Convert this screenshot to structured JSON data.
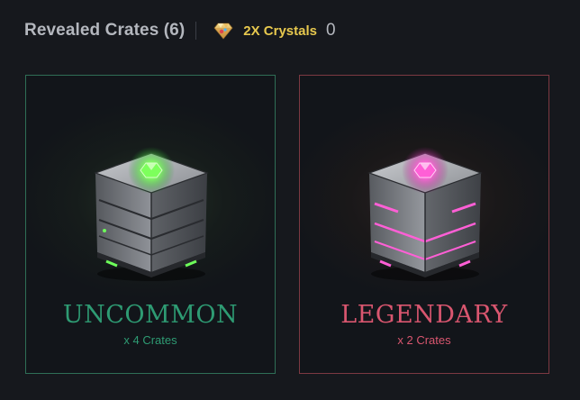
{
  "header": {
    "title": "Revealed Crates (6)",
    "crystal_label": "2X Crystals",
    "crystal_count": "0",
    "crystal_icon": "crystal-icon"
  },
  "cards": [
    {
      "rarity": "UNCOMMON",
      "count": "x 4 Crates",
      "accent": "#2e9b73",
      "glow": "#6dff5a",
      "icon": "crate-icon"
    },
    {
      "rarity": "LEGENDARY",
      "count": "x 2 Crates",
      "accent": "#d9566f",
      "glow": "#ff5fd6",
      "icon": "crate-icon"
    }
  ]
}
